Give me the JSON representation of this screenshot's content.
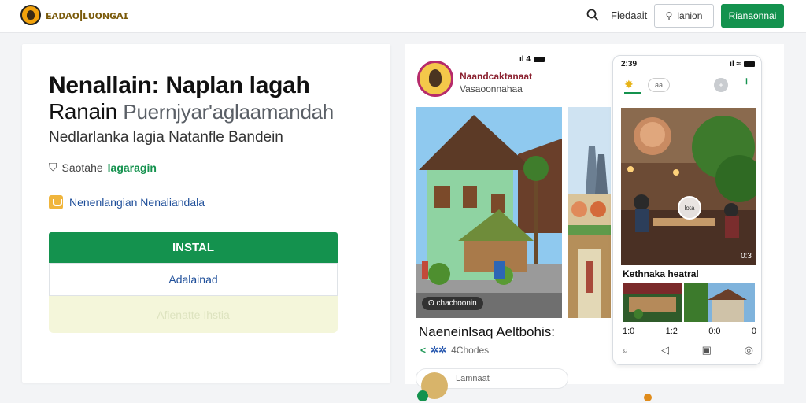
{
  "topbar": {
    "brand": "ᴇᴀᴅᴀᴏ|ʟᴜᴏɴɢᴀɪ",
    "nav_link": "Fiedaait",
    "outline_button": "lanion",
    "primary_button": "Rianaonnai"
  },
  "hero": {
    "title": "Nenallain: Naplan lagah",
    "subtitle_bold": "Ranain",
    "subtitle_muted": "Puernjyar'aglaamandah",
    "tagline": "Nedlarlanka lagia Natanfle Bandein",
    "meta_prefix": "Saotahe",
    "meta_accent": "lagaragin",
    "promo": "Nenenlangian Nenaliandala",
    "install_button": "INSTAL",
    "add_button": "Adalainad",
    "disabled_button": "Afienatte Ihstia"
  },
  "listing": {
    "app_name": "Naandcaktanaat",
    "developer": "Vasaoonnahaa",
    "status_time": "ıl 4",
    "screenshot_badge": "ʘ chachoonin",
    "title": "Naeneinlsaq Aeltbohis:",
    "ratings_text": "4Chodes",
    "bottom_pill": "Lamnaat"
  },
  "phone": {
    "time": "2:39",
    "signal": "ıl ≈",
    "tab_pill": "aa",
    "add_symbol": "+",
    "dots": "ⵑ",
    "play_label": "lota",
    "photo_time": "0:3",
    "section_title": "Kethnaka heatral",
    "stats": [
      "1:0",
      "1:2",
      "0:0",
      "0"
    ],
    "nav_icons": [
      "⌕",
      "◁",
      "▣",
      "◎"
    ]
  },
  "colors": {
    "accent_green": "#14924e",
    "link_blue": "#1f4f9a",
    "disabled_bg": "#f4f6da"
  }
}
